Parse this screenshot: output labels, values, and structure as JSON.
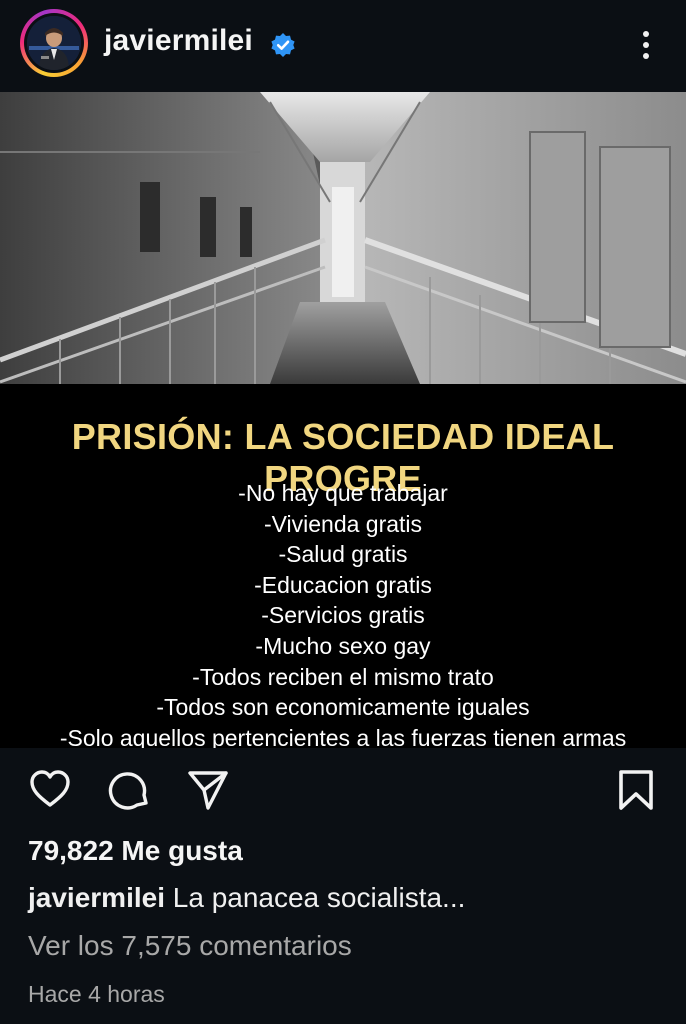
{
  "post": {
    "username": "javiermilei",
    "verified": true,
    "meme": {
      "title": "PRISIÓN: LA SOCIEDAD IDEAL PROGRE",
      "lines": [
        "-No hay que trabajar",
        "-Vivienda gratis",
        "-Salud gratis",
        "-Educacion gratis",
        "-Servicios gratis",
        "-Mucho sexo gay",
        "-Todos reciben el mismo trato",
        "-Todos son economicamente iguales",
        "-Solo aquellos pertencientes a las fuerzas tienen armas"
      ]
    },
    "likes": "79,822 Me gusta",
    "caption_user": "javiermilei",
    "caption_text": "La panacea socialista...",
    "comments_link": "Ver los 7,575 comentarios",
    "time": "Hace 4 horas"
  },
  "icons": {
    "verified": "verified-badge-icon",
    "more": "more-vertical-icon",
    "like": "heart-icon",
    "comment": "comment-icon",
    "share": "send-icon",
    "save": "bookmark-icon"
  },
  "colors": {
    "background": "#0b0f14",
    "verified": "#2f95f6",
    "meme_title": "#f1d680",
    "muted": "#a8a8a8"
  }
}
